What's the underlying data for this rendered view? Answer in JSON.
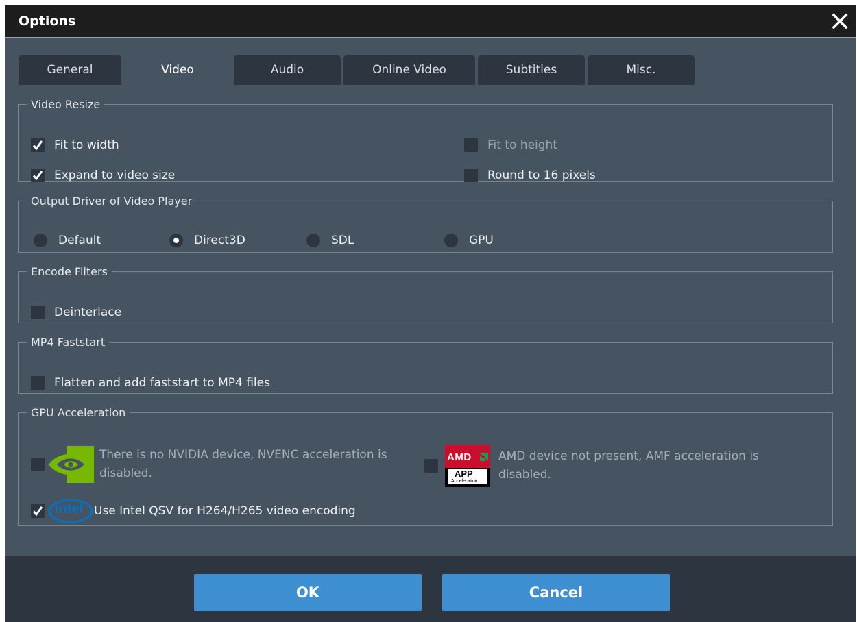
{
  "window": {
    "title": "Options"
  },
  "tabs": [
    {
      "label": "General",
      "active": false
    },
    {
      "label": "Video",
      "active": true
    },
    {
      "label": "Audio",
      "active": false
    },
    {
      "label": "Online Video",
      "active": false
    },
    {
      "label": "Subtitles",
      "active": false
    },
    {
      "label": "Misc.",
      "active": false
    }
  ],
  "video_resize": {
    "legend": "Video Resize",
    "fit_to_width": {
      "label": "Fit to width",
      "checked": true
    },
    "fit_to_height": {
      "label": "Fit to height",
      "checked": false,
      "disabled": true
    },
    "expand_to_video_size": {
      "label": "Expand to video size",
      "checked": true
    },
    "round_to_16": {
      "label": "Round to 16 pixels",
      "checked": false
    }
  },
  "output_driver": {
    "legend": "Output Driver of Video Player",
    "options": [
      "Default",
      "Direct3D",
      "SDL",
      "GPU"
    ],
    "selected": "Direct3D"
  },
  "encode_filters": {
    "legend": "Encode Filters",
    "deinterlace": {
      "label": "Deinterlace",
      "checked": false
    }
  },
  "mp4_faststart": {
    "legend": "MP4 Faststart",
    "flatten": {
      "label": "Flatten and add faststart to MP4 files",
      "checked": false
    }
  },
  "gpu_acceleration": {
    "legend": "GPU Acceleration",
    "nvidia": {
      "line1": "There is no NVIDIA device, NVENC acceleration is",
      "line2": "disabled.",
      "checked": false
    },
    "amd": {
      "line1": "AMD device not present, AMF acceleration is",
      "line2": "disabled.",
      "checked": false,
      "logo_top": "AMD",
      "logo_mid": "APP",
      "logo_bottom": "Acceleration"
    },
    "intel": {
      "label": "Use Intel QSV for H264/H265 video encoding",
      "checked": true,
      "logo_text": "intel"
    }
  },
  "buttons": {
    "ok": "OK",
    "cancel": "Cancel"
  },
  "colors": {
    "window_bg": "#465461",
    "dark": "#2d3640",
    "titlebar": "#1d1d1e",
    "accent": "#3d8fd1"
  },
  "icons": {
    "close": "close-icon",
    "check": "check-icon",
    "nvidia": "nvidia-logo-icon",
    "amd": "amd-app-logo-icon",
    "intel": "intel-logo-icon"
  }
}
